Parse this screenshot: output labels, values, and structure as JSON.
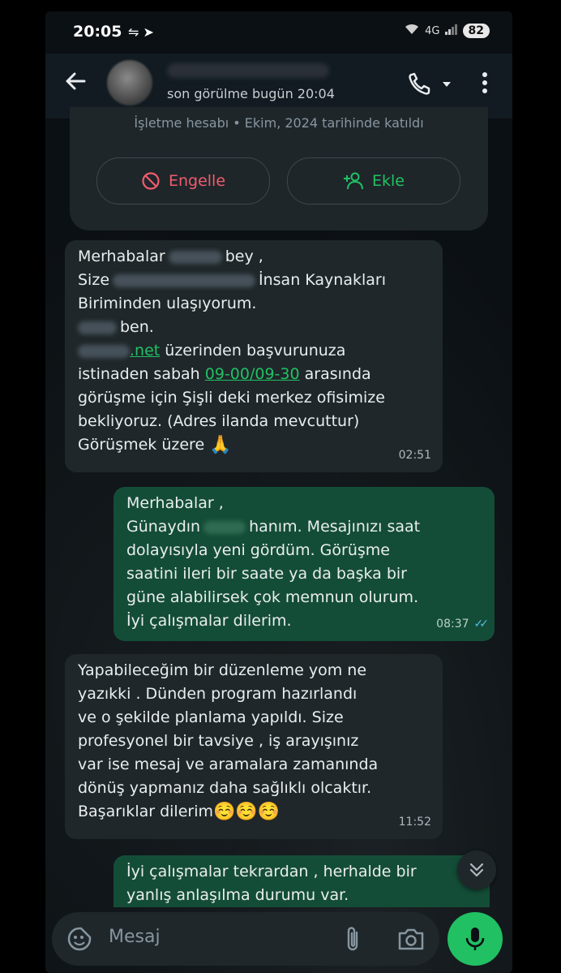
{
  "status_bar": {
    "time": "20:05",
    "icons": "⇋ ➤",
    "network": "4G",
    "battery": "82"
  },
  "header": {
    "last_seen": "son görülme bugün 20:04"
  },
  "business": {
    "info": "İşletme hesabı • Ekim, 2024 tarihinde katıldı",
    "block_label": "Engelle",
    "add_label": "Ekle"
  },
  "messages": [
    {
      "direction": "in",
      "lines": {
        "l1a": "Merhabalar",
        "l1b": "bey ,",
        "l2a": "Size",
        "l2b": "İnsan Kaynakları",
        "l3": "Biriminden ulaşıyorum.",
        "l4": "ben.",
        "l5_link": ".net",
        "l5b": "üzerinden başvurunuza",
        "l6a": "istinaden sabah",
        "l6_link": "09-00/09-30",
        "l6b": "arasında",
        "l7": "görüşme için Şişli deki merkez ofisimize",
        "l8": "bekliyoruz. (Adres ilanda mevcuttur)",
        "l9": "Görüşmek üzere",
        "emoji": "🙏"
      },
      "time": "02:51"
    },
    {
      "direction": "out",
      "lines": {
        "l1": "Merhabalar ,",
        "l2a": "Günaydın",
        "l2b": "hanım. Mesajınızı saat",
        "l3": "dolayısıyla yeni gördüm. Görüşme",
        "l4": "saatini ileri bir saate ya da başka bir",
        "l5": "güne alabilirsek çok memnun olurum.",
        "l6": "İyi çalışmalar dilerim."
      },
      "time": "08:37",
      "ticks": "✓✓"
    },
    {
      "direction": "in",
      "lines": {
        "l1": "Yapabileceğim bir düzenleme yom ne",
        "l2": "yazıkki . Dünden program hazırlandı",
        "l3": "ve o şekilde planlama yapıldı. Size",
        "l4": "profesyonel bir tavsiye , iş arayışınız",
        "l5": "var ise mesaj ve aramalara zamanında",
        "l6": "dönüş yapmanız daha sağlıklı olcaktır.",
        "l7": "Başarıklar dilerim",
        "emoji": "☺️☺️☺️"
      },
      "time": "11:52"
    },
    {
      "direction": "out",
      "lines": {
        "l1": "İyi çalışmalar tekrardan , herhalde bir",
        "l2": "yanlış anlaşılma durumu var."
      }
    }
  ],
  "composer": {
    "placeholder": "Mesaj"
  },
  "colors": {
    "outgoing": "#144d37",
    "incoming": "#1f272a",
    "accent": "#21c063",
    "block": "#f15c6d"
  }
}
